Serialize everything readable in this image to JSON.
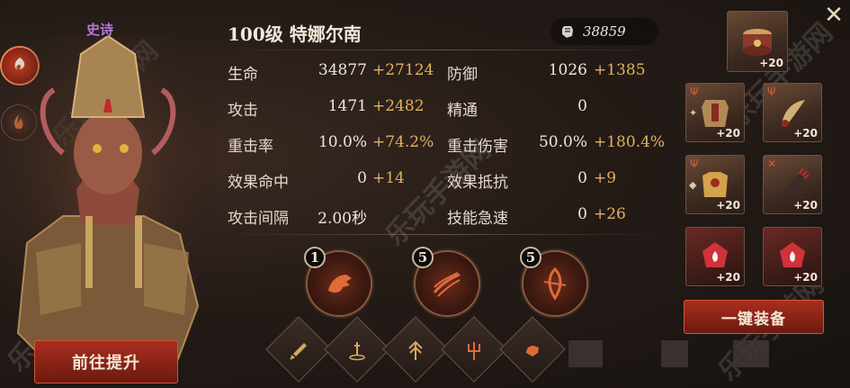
{
  "hero": {
    "tier": "史诗",
    "title": "100级  特娜尔南",
    "power": "38859",
    "upgrade_label": "前往提升"
  },
  "rail": [
    {
      "icon": "fire-swirl-icon"
    },
    {
      "icon": "flame-icon"
    }
  ],
  "stats": [
    {
      "label": "生命",
      "value": "34877",
      "bonus": "+27124"
    },
    {
      "label": "防御",
      "value": "1026",
      "bonus": "+1385"
    },
    {
      "label": "攻击",
      "value": "1471",
      "bonus": "+2482"
    },
    {
      "label": "精通",
      "value": "0",
      "bonus": ""
    },
    {
      "label": "重击率",
      "value": "10.0%",
      "bonus": "+74.2%"
    },
    {
      "label": "重击伤害",
      "value": "50.0%",
      "bonus": "+180.4%"
    },
    {
      "label": "效果命中",
      "value": "0",
      "bonus": "+14"
    },
    {
      "label": "效果抵抗",
      "value": "0",
      "bonus": "+9"
    },
    {
      "label": "攻击间隔",
      "value": "2.00秒",
      "bonus": ""
    },
    {
      "label": "技能急速",
      "value": "0",
      "bonus": "+26"
    }
  ],
  "skills": [
    {
      "level": "1",
      "icon": "dragon-head-icon"
    },
    {
      "level": "5",
      "icon": "claw-slash-icon"
    },
    {
      "level": "5",
      "icon": "blade-swirl-icon"
    }
  ],
  "bottom_icons": [
    "sword-icon",
    "sword-ground-icon",
    "trident-up-icon",
    "trident-icon",
    "fist-icon"
  ],
  "equipment": [
    {
      "name": "relic-drum-icon",
      "level": "+20"
    },
    {
      "name": "armor-chest-icon",
      "level": "+20"
    },
    {
      "name": "curved-blade-icon",
      "level": "+20"
    },
    {
      "name": "gold-armor-icon",
      "level": "+20"
    },
    {
      "name": "claw-gauntlet-icon",
      "level": "+20"
    },
    {
      "name": "red-gem-icon",
      "level": "+20"
    },
    {
      "name": "red-gem-icon",
      "level": "+20"
    }
  ],
  "equip_all_label": "一键装备",
  "watermark": "乐玩手游网",
  "colors": {
    "accent_red": "#a82e1d",
    "bonus_gold": "#e1b25e",
    "tier_purple": "#b57ae0"
  }
}
